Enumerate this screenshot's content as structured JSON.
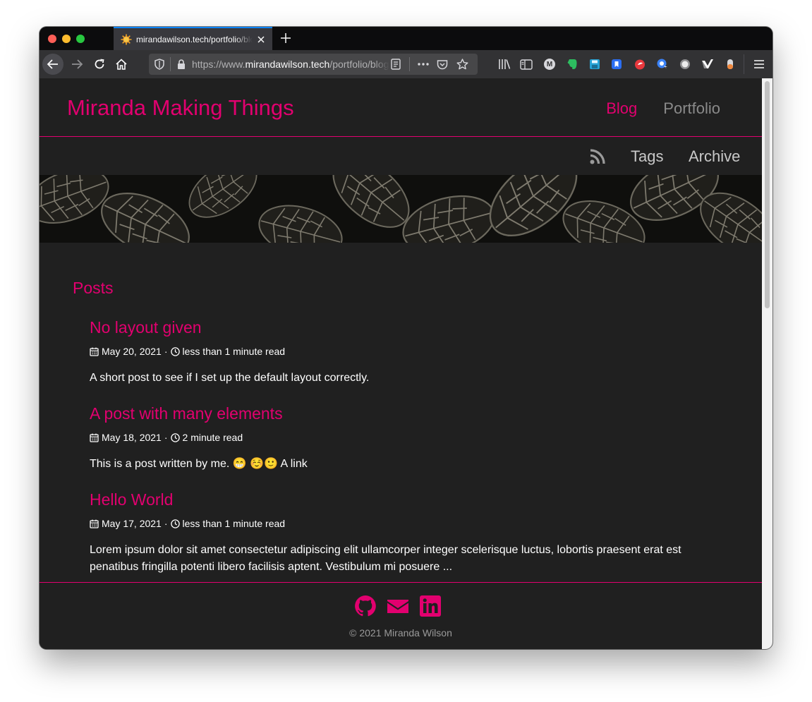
{
  "browser": {
    "tab_title": "mirandawilson.tech/portfolio/blog",
    "url_prefix": "https://www.",
    "url_domain": "mirandawilson.tech",
    "url_path": "/portfolio/blog/"
  },
  "site": {
    "title": "Miranda Making Things",
    "nav": {
      "blog": "Blog",
      "portfolio": "Portfolio"
    },
    "subnav": {
      "tags": "Tags",
      "archive": "Archive"
    }
  },
  "posts_heading": "Posts",
  "posts": [
    {
      "title": "No layout given",
      "date": "May 20, 2021",
      "read_time": "less than 1 minute read",
      "excerpt": "A short post to see if I set up the default layout correctly."
    },
    {
      "title": "A post with many elements",
      "date": "May 18, 2021",
      "read_time": "2 minute read",
      "excerpt": "This is a post written by me. 😁 ☺️🙂 A link"
    },
    {
      "title": "Hello World",
      "date": "May 17, 2021",
      "read_time": "less than 1 minute read",
      "excerpt": "Lorem ipsum dolor sit amet consectetur adipiscing elit ullamcorper integer scelerisque luctus, lobortis praesent erat est penatibus fringilla potenti libero facilisis aptent. Vestibulum mi posuere ..."
    }
  ],
  "footer": {
    "copyright": "© 2021 Miranda Wilson"
  },
  "colors": {
    "accent": "#e2006f",
    "page_bg": "#202020",
    "browser_chrome": "#323234"
  }
}
